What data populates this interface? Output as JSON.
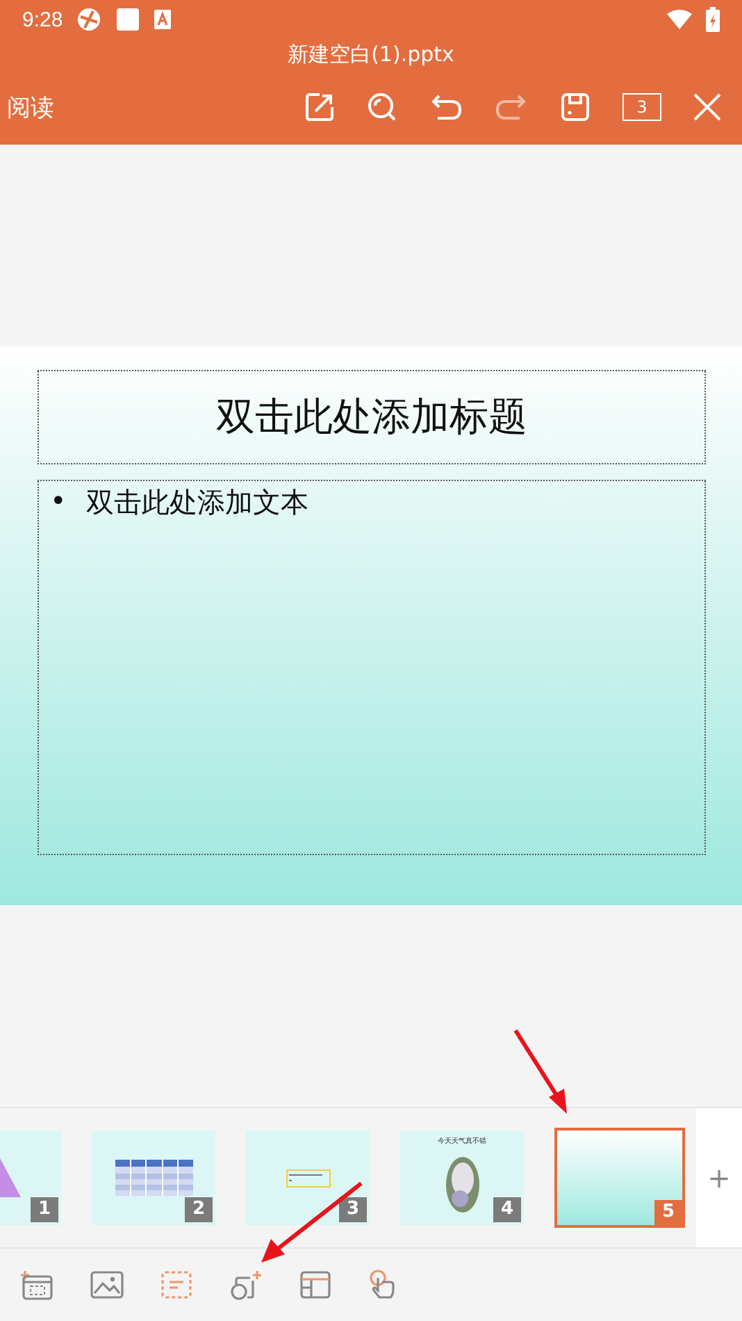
{
  "status_bar": {
    "time": "9:28"
  },
  "window": {
    "title": "新建空白(1).pptx"
  },
  "toolbar": {
    "mode": "阅读",
    "page_count": "3"
  },
  "slide": {
    "title_placeholder": "双击此处添加标题",
    "bullet": "•",
    "body_placeholder": "双击此处添加文本"
  },
  "thumbnails": [
    {
      "kind": "shape",
      "number": "1",
      "selected": false
    },
    {
      "kind": "table",
      "number": "2",
      "selected": false
    },
    {
      "kind": "textbox",
      "number": "3",
      "selected": false
    },
    {
      "kind": "photo",
      "number": "4",
      "selected": false,
      "title": "今天天气真不错"
    },
    {
      "kind": "blank",
      "number": "5",
      "selected": true
    }
  ],
  "add_slide": "+"
}
